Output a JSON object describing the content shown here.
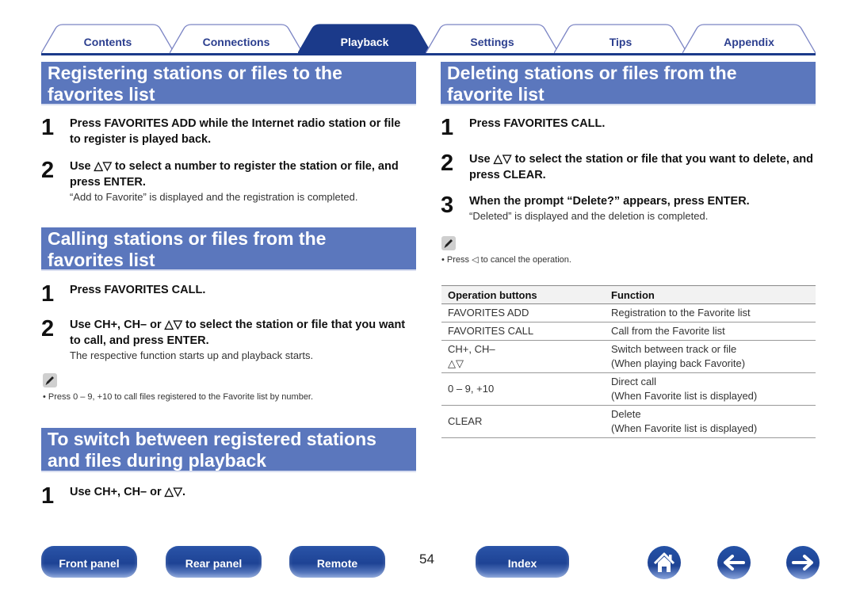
{
  "tabs": [
    {
      "label": "Contents",
      "active": false
    },
    {
      "label": "Connections",
      "active": false
    },
    {
      "label": "Playback",
      "active": true
    },
    {
      "label": "Settings",
      "active": false
    },
    {
      "label": "Tips",
      "active": false
    },
    {
      "label": "Appendix",
      "active": false
    }
  ],
  "colors": {
    "accent": "#1b3a8a",
    "section_header": "#5b77bd",
    "tab_text": "#2c3f8f"
  },
  "left": {
    "register": {
      "title_line1": "Registering stations or files to the",
      "title_line2": "favorites list",
      "steps": [
        {
          "num": "1",
          "text": "Press FAVORITES ADD while the Internet radio station or file to register is played back.",
          "desc": ""
        },
        {
          "num": "2",
          "text": "Use △▽ to select a number to register the station or file, and press ENTER.",
          "desc": "“Add to Favorite” is displayed and the registration is completed."
        }
      ]
    },
    "calling": {
      "title_line1": "Calling stations or files from the",
      "title_line2": "favorites list",
      "steps": [
        {
          "num": "1",
          "text": "Press FAVORITES CALL.",
          "desc": ""
        },
        {
          "num": "2",
          "text": "Use CH+, CH– or △▽ to select the station or file that you want to call, and press ENTER.",
          "desc": "The respective function starts up and playback starts."
        }
      ],
      "note_icon": "pencil-note-icon",
      "note": "• Press 0 – 9, +10 to call files registered to the Favorite list by number."
    },
    "switching": {
      "title_line1": "To switch between registered stations",
      "title_line2": "and files during playback",
      "steps": [
        {
          "num": "1",
          "text": "Use CH+, CH– or △▽.",
          "desc": ""
        }
      ]
    }
  },
  "right": {
    "deleting": {
      "title_line1": "Deleting stations or files from the",
      "title_line2": "favorite list",
      "steps": [
        {
          "num": "1",
          "text": "Press FAVORITES CALL.",
          "desc": ""
        },
        {
          "num": "2",
          "text": "Use △▽ to select the station or file that you want to delete, and press CLEAR.",
          "desc": ""
        },
        {
          "num": "3",
          "text": "When the prompt “Delete?” appears, press ENTER.",
          "desc": "“Deleted” is displayed and the deletion is completed."
        }
      ],
      "note_icon": "pencil-note-icon",
      "note": "• Press ◁ to cancel the operation."
    },
    "table": {
      "headers": [
        "Operation buttons",
        "Function"
      ],
      "rows": [
        {
          "button": "FAVORITES ADD",
          "button2": "",
          "func": "Registration to the Favorite list",
          "func2": ""
        },
        {
          "button": "FAVORITES CALL",
          "button2": "",
          "func": "Call from the Favorite list",
          "func2": ""
        },
        {
          "button": "CH+, CH–",
          "button2": "△▽",
          "func": "Switch between track or file",
          "func2": "(When playing back Favorite)"
        },
        {
          "button": "0 – 9, +10",
          "button2": "",
          "func": "Direct call",
          "func2": "(When Favorite list is displayed)"
        },
        {
          "button": "CLEAR",
          "button2": "",
          "func": "Delete",
          "func2": "(When Favorite list is displayed)"
        }
      ]
    }
  },
  "footer": {
    "buttons": [
      "Front panel",
      "Rear panel",
      "Remote"
    ],
    "page_number": "54",
    "index_label": "Index",
    "icons": [
      "home-icon",
      "back-arrow-icon",
      "forward-arrow-icon"
    ]
  }
}
